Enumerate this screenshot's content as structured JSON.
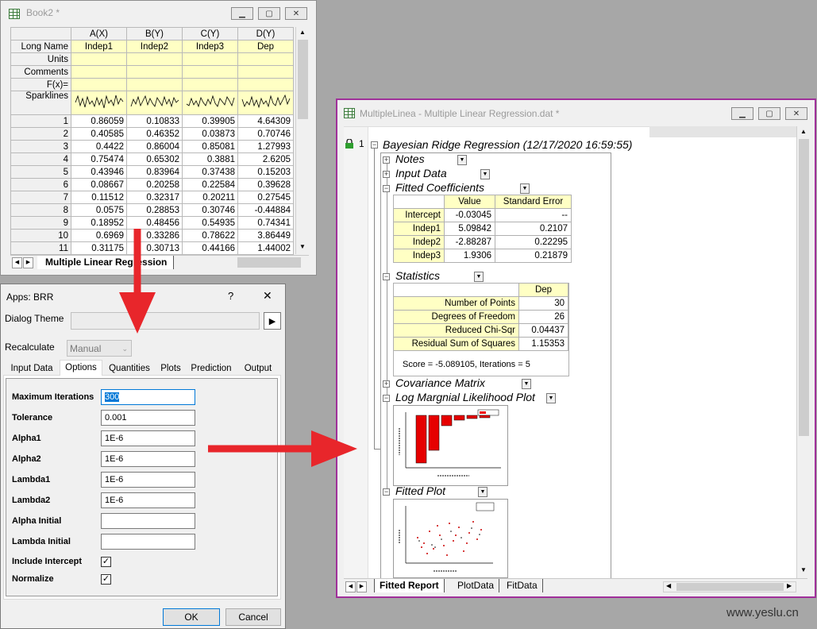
{
  "book": {
    "title": "Book2 *",
    "columns": [
      "A(X)",
      "B(Y)",
      "C(Y)",
      "D(Y)"
    ],
    "meta_rows": [
      {
        "label": "Long Name",
        "values": [
          "Indep1",
          "Indep2",
          "Indep3",
          "Dep"
        ]
      },
      {
        "label": "Units",
        "values": [
          "",
          "",
          "",
          ""
        ]
      },
      {
        "label": "Comments",
        "values": [
          "",
          "",
          "",
          ""
        ]
      },
      {
        "label": "F(x)=",
        "values": [
          "",
          "",
          "",
          ""
        ]
      }
    ],
    "sparklines_label": "Sparklines",
    "rows": [
      {
        "n": "1",
        "v": [
          "0.86059",
          "0.10833",
          "0.39905",
          "4.64309"
        ]
      },
      {
        "n": "2",
        "v": [
          "0.40585",
          "0.46352",
          "0.03873",
          "0.70746"
        ]
      },
      {
        "n": "3",
        "v": [
          "0.4422",
          "0.86004",
          "0.85081",
          "1.27993"
        ]
      },
      {
        "n": "4",
        "v": [
          "0.75474",
          "0.65302",
          "0.3881",
          "2.6205"
        ]
      },
      {
        "n": "5",
        "v": [
          "0.43946",
          "0.83964",
          "0.37438",
          "0.15203"
        ]
      },
      {
        "n": "6",
        "v": [
          "0.08667",
          "0.20258",
          "0.22584",
          "0.39628"
        ]
      },
      {
        "n": "7",
        "v": [
          "0.11512",
          "0.32317",
          "0.20211",
          "0.27545"
        ]
      },
      {
        "n": "8",
        "v": [
          "0.0575",
          "0.28853",
          "0.30746",
          "-0.44884"
        ]
      },
      {
        "n": "9",
        "v": [
          "0.18952",
          "0.48456",
          "0.54935",
          "0.74341"
        ]
      },
      {
        "n": "10",
        "v": [
          "0.6969",
          "0.33286",
          "0.78622",
          "3.86449"
        ]
      },
      {
        "n": "11",
        "v": [
          "0.31175",
          "0.30713",
          "0.44166",
          "1.44002"
        ]
      }
    ],
    "sheet_tab": "Multiple Linear Regression"
  },
  "dialog": {
    "title": "Apps: BRR",
    "help": "?",
    "close": "✕",
    "theme_label": "Dialog Theme",
    "theme_value": "",
    "theme_arrow": "▶",
    "recalc_label": "Recalculate",
    "recalc_value": "Manual",
    "tabs": [
      "Input Data",
      "Options",
      "Quantities",
      "Plots",
      "Prediction",
      "Output"
    ],
    "fields": [
      {
        "label": "Maximum Iterations",
        "value": "300"
      },
      {
        "label": "Tolerance",
        "value": "0.001"
      },
      {
        "label": "Alpha1",
        "value": "1E-6"
      },
      {
        "label": "Alpha2",
        "value": "1E-6"
      },
      {
        "label": "Lambda1",
        "value": "1E-6"
      },
      {
        "label": "Lambda2",
        "value": "1E-6"
      },
      {
        "label": "Alpha Initial",
        "value": ""
      },
      {
        "label": "Lambda Initial",
        "value": ""
      }
    ],
    "checks": [
      {
        "label": "Include Intercept",
        "checked": "✓"
      },
      {
        "label": "Normalize",
        "checked": "✓"
      }
    ],
    "ok": "OK",
    "cancel": "Cancel"
  },
  "report": {
    "title": "MultipleLinea - Multiple Linear Regression.dat *",
    "index": "1",
    "root": "Bayesian Ridge Regression (12/17/2020 16:59:55)",
    "notes": "Notes",
    "input_data": "Input Data",
    "fitted_coefficients": "Fitted Coefficients",
    "coef_headers": [
      "Value",
      "Standard Error"
    ],
    "coef_rows": [
      {
        "name": "Intercept",
        "value": "-0.03045",
        "se": "--"
      },
      {
        "name": "Indep1",
        "value": "5.09842",
        "se": "0.2107"
      },
      {
        "name": "Indep2",
        "value": "-2.88287",
        "se": "0.22295"
      },
      {
        "name": "Indep3",
        "value": "1.9306",
        "se": "0.21879"
      }
    ],
    "statistics": "Statistics",
    "stat_header": "Dep",
    "stat_rows": [
      {
        "name": "Number of Points",
        "value": "30"
      },
      {
        "name": "Degrees of Freedom",
        "value": "26"
      },
      {
        "name": "Reduced Chi-Sqr",
        "value": "0.04437"
      },
      {
        "name": "Residual Sum of Squares",
        "value": "1.15353"
      }
    ],
    "score_note": "Score = -5.089105, Iterations = 5",
    "covariance": "Covariance Matrix",
    "log_ml_plot": "Log Margnial Likelihood Plot",
    "fitted_plot": "Fitted Plot",
    "bottom_tabs": [
      "Fitted Report",
      "PlotData",
      "FitData"
    ]
  },
  "watermark": "www.yeslu.cn",
  "colors": {
    "arrow": "#e8262b",
    "report_border": "#a0309a",
    "meta_yellow": "#ffffc4"
  }
}
